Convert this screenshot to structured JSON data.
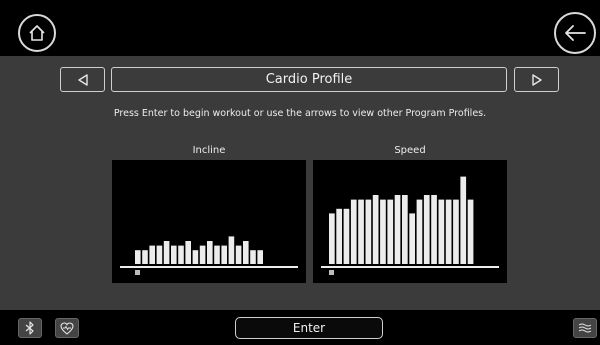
{
  "header": {
    "home_icon": "home-icon",
    "back_icon": "back-arrow-icon"
  },
  "profile": {
    "title": "Cardio Profile",
    "prev_icon": "triangle-left-icon",
    "next_icon": "triangle-right-icon"
  },
  "instructions": "Press Enter to begin workout or use the arrows to view other Program Profiles.",
  "charts": {
    "incline_label": "Incline",
    "speed_label": "Speed"
  },
  "chart_data": [
    {
      "type": "bar",
      "title": "Incline",
      "values": [
        1.5,
        1.5,
        2,
        2,
        2.5,
        2,
        2,
        2.5,
        1.5,
        2,
        2.5,
        2,
        2,
        3,
        2,
        2.5,
        1.5,
        1.5
      ],
      "ylim": [
        0,
        10
      ],
      "current_segment": 1,
      "grid": false
    },
    {
      "type": "bar",
      "title": "Speed",
      "values": [
        5.5,
        6,
        6,
        7,
        7,
        7,
        7.5,
        7,
        7,
        7.5,
        7.5,
        5.5,
        7,
        7.5,
        7.5,
        7,
        7,
        7,
        9.5,
        7
      ],
      "ylim": [
        0,
        10
      ],
      "current_segment": 1,
      "grid": false
    }
  ],
  "footer": {
    "enter_label": "Enter",
    "bluetooth_icon": "bluetooth-icon",
    "heart_icon": "heart-rate-icon",
    "fan_icon": "fan-wind-icon"
  },
  "colors": {
    "bar": "#ececec",
    "background": "#3b3b3b",
    "panel": "#000000",
    "marker": "#bdbdbd"
  }
}
